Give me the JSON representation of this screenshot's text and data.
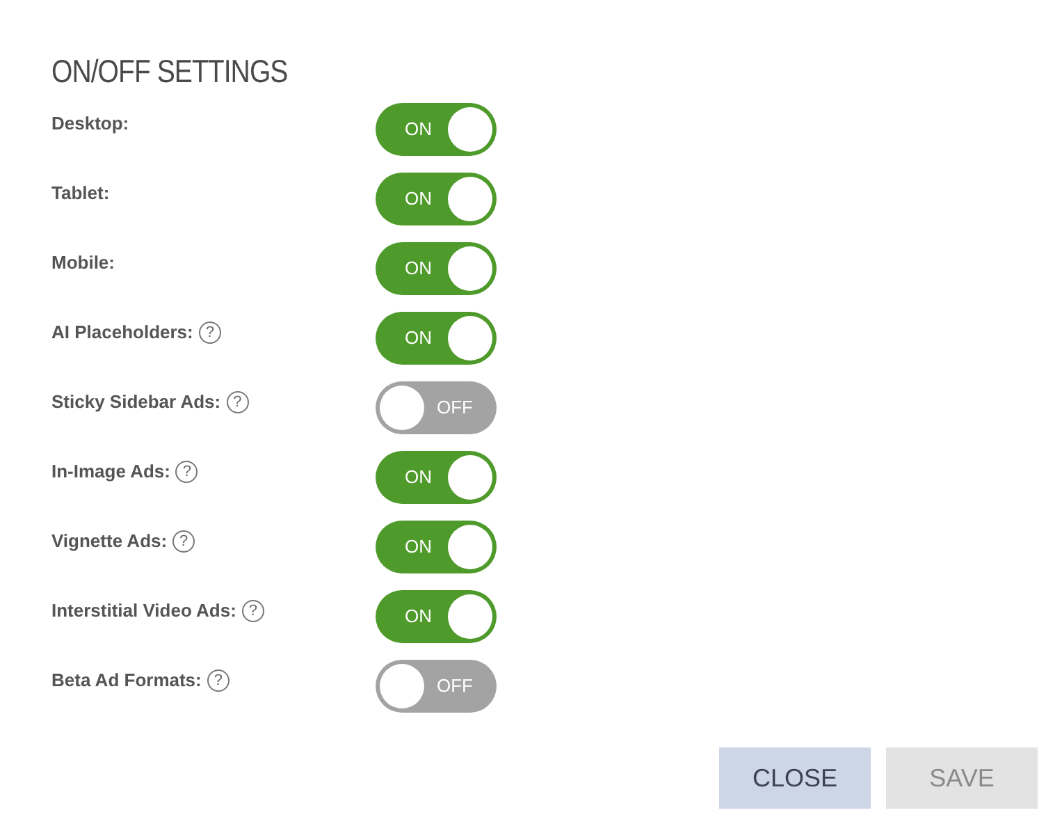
{
  "title": "ON/OFF SETTINGS",
  "settings": [
    {
      "label": "Desktop:",
      "on": true,
      "toggle_text": "ON"
    },
    {
      "label": "Tablet:",
      "on": true,
      "toggle_text": "ON"
    },
    {
      "label": "Mobile:",
      "on": true,
      "toggle_text": "ON"
    },
    {
      "label": "AI Placeholders:",
      "help": "?",
      "on": true,
      "toggle_text": "ON"
    },
    {
      "label": "Sticky Sidebar Ads:",
      "help": "?",
      "on": false,
      "toggle_text": "OFF"
    },
    {
      "label": "In-Image Ads:",
      "help": "?",
      "on": true,
      "toggle_text": "ON"
    },
    {
      "label": "Vignette Ads:",
      "help": "?",
      "on": true,
      "toggle_text": "ON"
    },
    {
      "label": "Interstitial Video Ads:",
      "help": "?",
      "on": true,
      "toggle_text": "ON"
    },
    {
      "label": "Beta Ad Formats:",
      "help": "?",
      "on": false,
      "toggle_text": "OFF"
    }
  ],
  "buttons": [
    {
      "label": "CLOSE",
      "disabled": false
    },
    {
      "label": "SAVE",
      "disabled": true
    }
  ]
}
